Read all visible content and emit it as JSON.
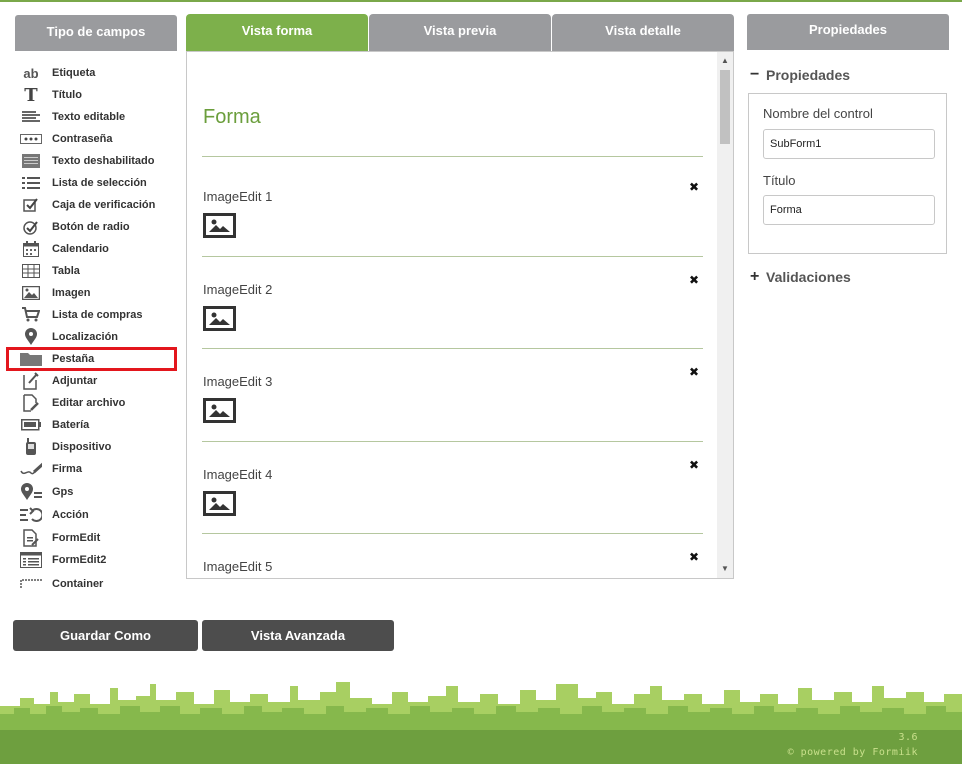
{
  "left_panel": {
    "header": "Tipo de campos",
    "fields": [
      {
        "label": "Etiqueta",
        "icon": "ab-icon"
      },
      {
        "label": "Título",
        "icon": "title-t-icon"
      },
      {
        "label": "Texto editable",
        "icon": "text-lines-icon"
      },
      {
        "label": "Contraseña",
        "icon": "password-dots-icon"
      },
      {
        "label": "Texto deshabilitado",
        "icon": "disabled-text-icon"
      },
      {
        "label": "Lista de selección",
        "icon": "list-icon"
      },
      {
        "label": "Caja de verificación",
        "icon": "checkbox-icon"
      },
      {
        "label": "Botón de radio",
        "icon": "radio-check-icon"
      },
      {
        "label": "Calendario",
        "icon": "calendar-icon"
      },
      {
        "label": "Tabla",
        "icon": "table-icon"
      },
      {
        "label": "Imagen",
        "icon": "image-icon"
      },
      {
        "label": "Lista de compras",
        "icon": "cart-icon"
      },
      {
        "label": "Localización",
        "icon": "location-pin-icon"
      },
      {
        "label": "Pestaña",
        "icon": "folder-tab-icon"
      },
      {
        "label": "Adjuntar",
        "icon": "attach-icon"
      },
      {
        "label": "Editar archivo",
        "icon": "edit-file-icon"
      },
      {
        "label": "Batería",
        "icon": "battery-icon"
      },
      {
        "label": "Dispositivo",
        "icon": "device-icon"
      },
      {
        "label": "Firma",
        "icon": "signature-icon"
      },
      {
        "label": "Gps",
        "icon": "gps-icon"
      },
      {
        "label": "Acción",
        "icon": "action-icon"
      },
      {
        "label": "FormEdit",
        "icon": "form-edit-icon"
      },
      {
        "label": "FormEdit2",
        "icon": "form-edit2-icon"
      },
      {
        "label": "Container",
        "icon": "container-icon"
      }
    ]
  },
  "tabs": [
    {
      "label": "Vista forma",
      "active": true
    },
    {
      "label": "Vista previa",
      "active": false
    },
    {
      "label": "Vista detalle",
      "active": false
    }
  ],
  "form": {
    "title": "Forma",
    "items": [
      {
        "label": "ImageEdit 1"
      },
      {
        "label": "ImageEdit 2"
      },
      {
        "label": "ImageEdit 3"
      },
      {
        "label": "ImageEdit 4"
      },
      {
        "label": "ImageEdit 5"
      }
    ],
    "close_glyph": "✖"
  },
  "right_panel": {
    "header": "Propiedades",
    "properties_section": {
      "sign": "−",
      "label": "Propiedades"
    },
    "control_name_label": "Nombre del control",
    "control_name_value": "SubForm1",
    "title_label": "Título",
    "title_value": "Forma",
    "validations_section": {
      "sign": "+",
      "label": "Validaciones"
    }
  },
  "buttons": {
    "save_as": "Guardar Como",
    "advanced_view": "Vista Avanzada"
  },
  "footer": {
    "version": "3.6",
    "powered_by": "© powered by Formiik"
  },
  "colors": {
    "accent_green": "#7db04b",
    "header_gray": "#9a9b9e",
    "button_dark": "#4d4d4d",
    "selection_red": "#e3161d"
  }
}
